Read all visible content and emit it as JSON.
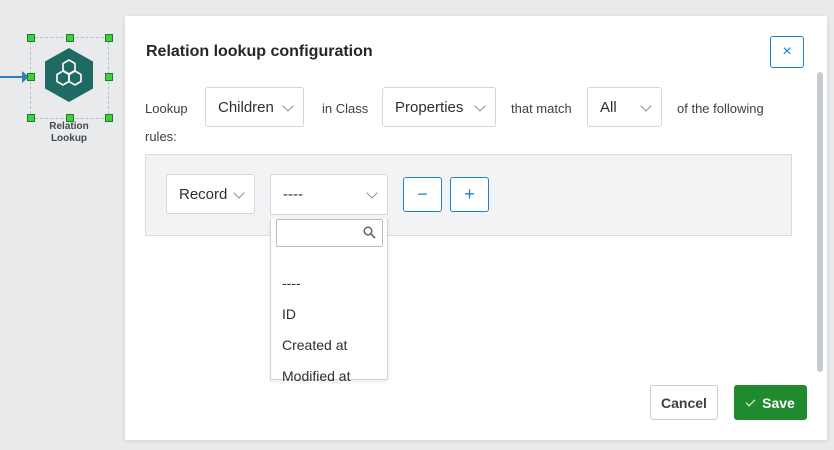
{
  "node": {
    "label_line1": "Relation",
    "label_line2": "Lookup"
  },
  "modal": {
    "title": "Relation lookup configuration",
    "close_label": "×",
    "lookup_label": "Lookup",
    "lookup_value": "Children",
    "in_class_label": "in Class",
    "class_value": "Properties",
    "that_match_label": "that match",
    "match_value": "All",
    "of_following_label": "of the following",
    "rules_label": "rules:",
    "rule": {
      "field_value": "Record",
      "operator_value": "----",
      "remove_label": "−",
      "add_label": "+"
    },
    "dropdown": {
      "search_value": "",
      "options": [
        "----",
        "ID",
        "Created at",
        "Modified at"
      ]
    },
    "cancel_label": "Cancel",
    "save_label": "Save"
  },
  "colors": {
    "accent": "#1f82c8",
    "save": "#208a2e",
    "node": "#1f6b63",
    "handle": "#3fcf3f"
  }
}
